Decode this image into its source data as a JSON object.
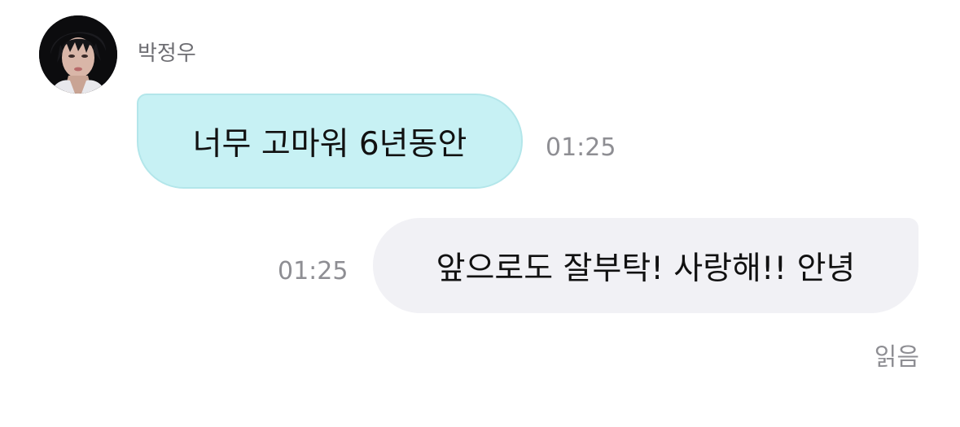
{
  "conversation": {
    "incoming": {
      "sender_name": "박정우",
      "text": "너무 고마워 6년동안",
      "time": "01:25"
    },
    "outgoing": {
      "text": "앞으로도 잘부탁! 사랑해!! 안녕",
      "time": "01:25",
      "read_status": "읽음"
    }
  },
  "colors": {
    "incoming_bubble": "#c7f1f4",
    "outgoing_bubble": "#f1f1f5",
    "meta_text": "#8e8e93"
  },
  "icons": {
    "avatar": "profile-photo"
  }
}
